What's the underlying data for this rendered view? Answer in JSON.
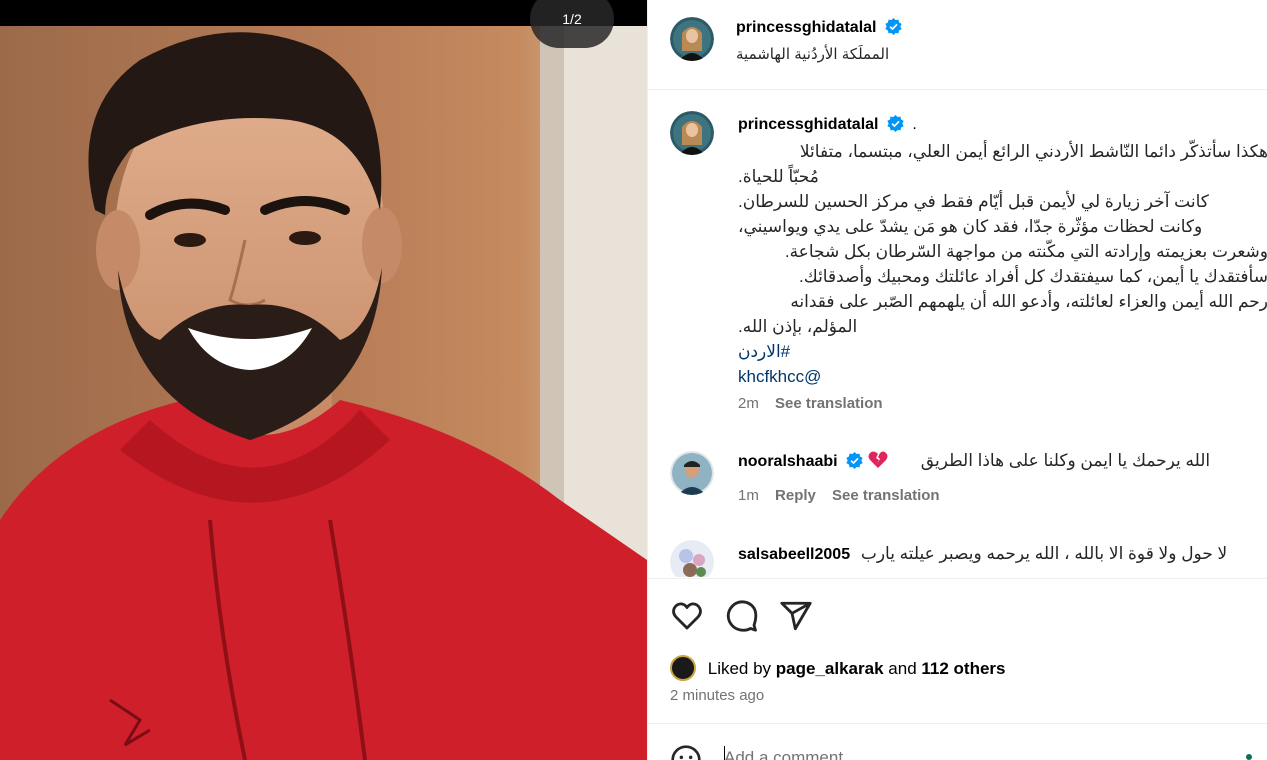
{
  "media": {
    "counter": "1/2",
    "alt_subject": "smiling young man in red hoodie"
  },
  "header": {
    "username": "princessghidatalal",
    "location": "المملَكة الأردُنية الهاشمية"
  },
  "caption": {
    "username": "princessghidatalal",
    "dot": ".",
    "lines": [
      "هكذا سأتذكّر دائما النّاشط الأردني الرائع أيمن العلي، مبتسما، متفائلا",
      "مُحبّاً للحياة.",
      "كانت آخر زيارة لي لأيمن قبل أيّام فقط في مركز الحسين للسرطان.",
      "وكانت لحظات مؤثّرة جدّا، فقد كان هو مَن يشدّ على يدي ويواسيني،",
      "وشعرت بعزيمته وإرادته التي مكّنته من مواجهة السّرطان بكل شجاعة.",
      "سأفتقدك يا أيمن، كما سيفتقدك كل أفراد عائلتك ومحبيك وأصدقائك.",
      "رحم الله أيمن والعزاء لعائلته، وأدعو الله أن يلهمهم الصّبر على فقدانه",
      "المؤلم، بإذن الله."
    ],
    "hashtag": "#الاردن",
    "mention": "khcfkhcc@",
    "time": "2m",
    "see_translation": "See translation"
  },
  "comments": [
    {
      "username": "nooralshaabi",
      "text": "الله يرحمك يا ايمن وكلنا على هاذا الطريق",
      "time": "1m",
      "reply": "Reply",
      "see_translation": "See translation",
      "emoji": "broken-heart"
    },
    {
      "username": "salsabeell2005",
      "text": "لا حول ولا قوة الا بالله ، الله يرحمه ويصبر عيلته يارب"
    }
  ],
  "likes": {
    "prefix": "Liked by",
    "user": "page_alkarak",
    "conj": "and",
    "others": "112 others"
  },
  "time_ago": "2 minutes ago",
  "add_comment": {
    "placeholder": "Add a comment..."
  },
  "colors": {
    "verified": "#0095f6",
    "link": "#00376b",
    "muted": "#737373",
    "hoodie": "#d3202c"
  }
}
